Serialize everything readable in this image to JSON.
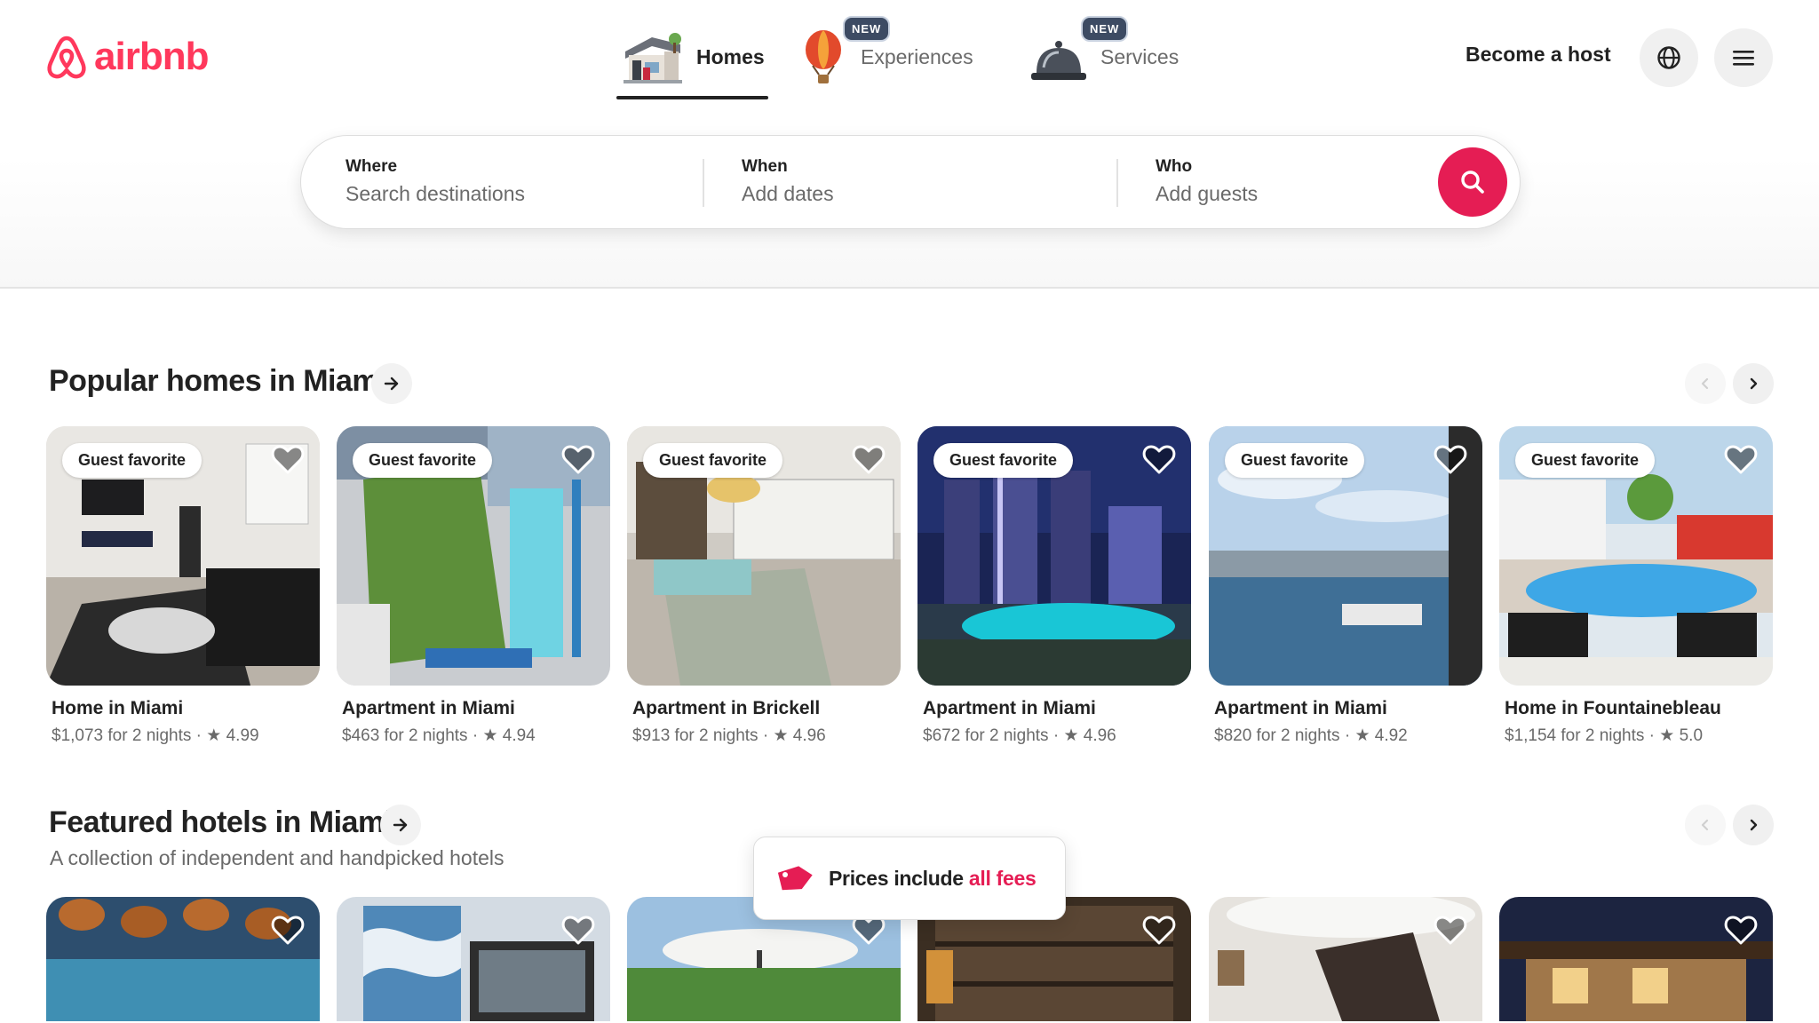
{
  "brand": {
    "name": "airbnb",
    "color": "#ff385c"
  },
  "nav": {
    "tabs": [
      {
        "label": "Homes",
        "active": true,
        "icon": "house-icon",
        "badge": ""
      },
      {
        "label": "Experiences",
        "active": false,
        "icon": "hot-air-balloon-icon",
        "badge": "NEW"
      },
      {
        "label": "Services",
        "active": false,
        "icon": "service-bell-icon",
        "badge": "NEW"
      }
    ],
    "host_link": "Become a host",
    "globe_icon": "globe-icon",
    "menu_icon": "hamburger-menu-icon"
  },
  "search": {
    "where": {
      "label": "Where",
      "placeholder": "Search destinations"
    },
    "when": {
      "label": "When",
      "placeholder": "Add dates"
    },
    "who": {
      "label": "Who",
      "placeholder": "Add guests"
    },
    "button_icon": "search-icon",
    "button_color": "#e51d54"
  },
  "popular": {
    "title": "Popular homes in Miami",
    "listings": [
      {
        "badge": "Guest favorite",
        "title": "Home in Miami",
        "price": "$1,073 for 2 nights",
        "rating": "4.99"
      },
      {
        "badge": "Guest favorite",
        "title": "Apartment in Miami",
        "price": "$463 for 2 nights",
        "rating": "4.94"
      },
      {
        "badge": "Guest favorite",
        "title": "Apartment in Brickell",
        "price": "$913 for 2 nights",
        "rating": "4.96"
      },
      {
        "badge": "Guest favorite",
        "title": "Apartment in Miami",
        "price": "$672 for 2 nights",
        "rating": "4.96"
      },
      {
        "badge": "Guest favorite",
        "title": "Apartment in Miami",
        "price": "$820 for 2 nights",
        "rating": "4.92"
      },
      {
        "badge": "Guest favorite",
        "title": "Home in Fountainebleau",
        "price": "$1,154 for 2 nights",
        "rating": "5.0"
      }
    ]
  },
  "hotels": {
    "title": "Featured hotels in Miami",
    "subtitle": "A collection of independent and handpicked hotels"
  },
  "toast": {
    "prefix": "Prices include ",
    "accent": "all fees",
    "icon": "price-tag-icon"
  }
}
